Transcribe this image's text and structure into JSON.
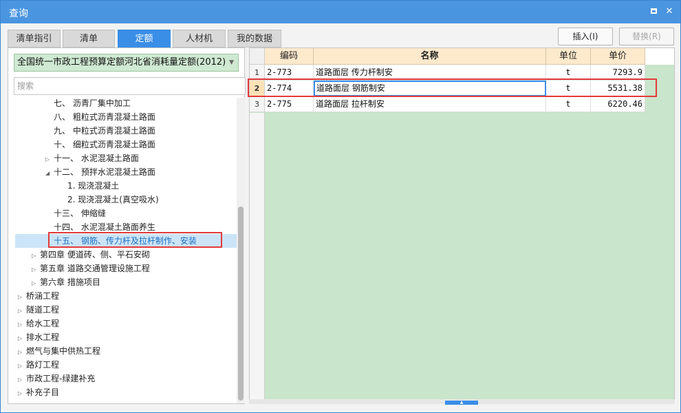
{
  "window": {
    "title": "查询"
  },
  "tabs": [
    "清单指引",
    "清单",
    "定额",
    "人材机",
    "我的数据"
  ],
  "active_tab": "定额",
  "toolbar": {
    "insert_label": "插入(I)",
    "replace_label": "替换(R)"
  },
  "quota_select": {
    "value": "全国统一市政工程预算定额河北省消耗量定额(2012)"
  },
  "search": {
    "placeholder": "搜索"
  },
  "tree": [
    {
      "label": "七、 沥青厂集中加工",
      "indent": 3,
      "toggle": ""
    },
    {
      "label": "八、 粗粒式沥青混凝土路面",
      "indent": 3,
      "toggle": ""
    },
    {
      "label": "九、 中粒式沥青混凝土路面",
      "indent": 3,
      "toggle": ""
    },
    {
      "label": "十、 细粒式沥青混凝土路面",
      "indent": 3,
      "toggle": ""
    },
    {
      "label": "十一、 水泥混凝土路面",
      "indent": 3,
      "toggle": "▷"
    },
    {
      "label": "十二、 预拌水泥混凝土路面",
      "indent": 3,
      "toggle": "◢"
    },
    {
      "label": "1. 现浇混凝土",
      "indent": 4,
      "toggle": ""
    },
    {
      "label": "2. 现浇混凝土(真空吸水)",
      "indent": 4,
      "toggle": ""
    },
    {
      "label": "十三、 伸缩缝",
      "indent": 3,
      "toggle": ""
    },
    {
      "label": "十四、 水泥混凝土路面养生",
      "indent": 3,
      "toggle": ""
    },
    {
      "label": "十五、 钢筋、传力杆及拉杆制作、安装",
      "indent": 3,
      "toggle": "",
      "selected": true
    },
    {
      "label": "第四章 便道砖、侧、平石安砌",
      "indent": 2,
      "toggle": "▷"
    },
    {
      "label": "第五章 道路交通管理设施工程",
      "indent": 2,
      "toggle": "▷"
    },
    {
      "label": "第六章 措施项目",
      "indent": 2,
      "toggle": "▷"
    },
    {
      "label": "桥涵工程",
      "indent": 1,
      "toggle": "▷"
    },
    {
      "label": "隧道工程",
      "indent": 1,
      "toggle": "▷"
    },
    {
      "label": "给水工程",
      "indent": 1,
      "toggle": "▷"
    },
    {
      "label": "排水工程",
      "indent": 1,
      "toggle": "▷"
    },
    {
      "label": "燃气与集中供热工程",
      "indent": 1,
      "toggle": "▷"
    },
    {
      "label": "路灯工程",
      "indent": 1,
      "toggle": "▷"
    },
    {
      "label": "市政工程-绿建补充",
      "indent": 1,
      "toggle": "▷"
    },
    {
      "label": "补充子目",
      "indent": 1,
      "toggle": "▷"
    }
  ],
  "grid": {
    "columns": [
      "编码",
      "名称",
      "单位",
      "单价"
    ],
    "rows": [
      {
        "no": "1",
        "code": "2-773",
        "name": "道路面层 传力杆制安",
        "unit": "t",
        "price": "7293.9"
      },
      {
        "no": "2",
        "code": "2-774",
        "name": "道路面层 钢筋制安",
        "unit": "t",
        "price": "5531.38",
        "current": true
      },
      {
        "no": "3",
        "code": "2-775",
        "name": "道路面层 拉杆制安",
        "unit": "t",
        "price": "6220.46"
      }
    ]
  },
  "colors": {
    "accent": "#3a8ee6",
    "highlight": "#e23a3a",
    "grid_bg": "#c9e5cb"
  }
}
